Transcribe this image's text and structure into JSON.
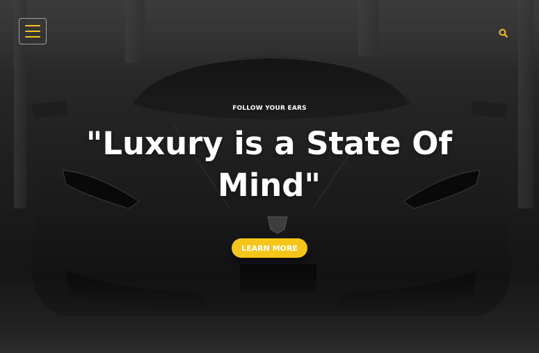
{
  "header": {
    "menu_icon": "hamburger-menu-icon",
    "search_icon": "search-icon"
  },
  "hero": {
    "eyebrow": "FOLLOW YOUR EARS",
    "headline": "\"Luxury is a State Of Mind\"",
    "cta_label": "LEARN MORE",
    "background_image": "black sports car in showroom"
  },
  "colors": {
    "accent": "#f5c518",
    "text": "#ffffff",
    "overlay": "#000000"
  }
}
